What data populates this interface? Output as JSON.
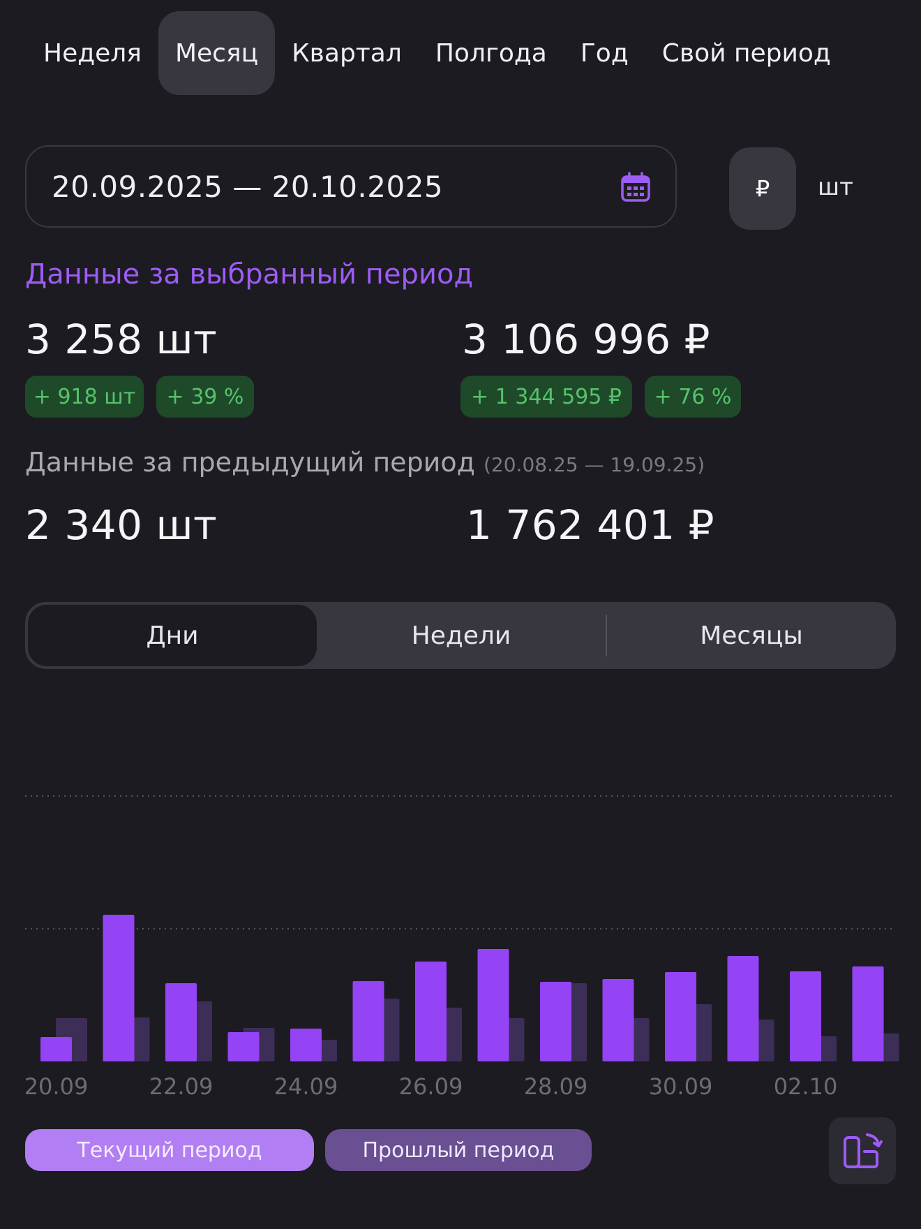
{
  "period_tabs": [
    {
      "label": "Неделя",
      "active": false
    },
    {
      "label": "Месяц",
      "active": true
    },
    {
      "label": "Квартал",
      "active": false
    },
    {
      "label": "Полгода",
      "active": false
    },
    {
      "label": "Год",
      "active": false
    },
    {
      "label": "Свой период",
      "active": false
    }
  ],
  "date_range": {
    "value": "20.09.2025 — 20.10.2025",
    "icon": "calendar-icon"
  },
  "unit_toggle": {
    "rub": "₽",
    "sht": "шт",
    "selected": "₽"
  },
  "selected_period": {
    "title": "Данные за выбранный период",
    "qty": "3 258 шт",
    "qty_badges": [
      "+ 918 шт",
      "+ 39 %"
    ],
    "sum": "3 106 996 ₽",
    "sum_badges": [
      "+ 1 344 595 ₽",
      "+ 76 %"
    ]
  },
  "previous_period": {
    "title": "Данные за предыдущий период",
    "range": "(20.08.25 — 19.09.25)",
    "qty": "2 340 шт",
    "sum": "1 762 401 ₽"
  },
  "granularity": {
    "options": [
      "Дни",
      "Недели",
      "Месяцы"
    ],
    "selected": "Дни"
  },
  "colors": {
    "current": "#9443f5",
    "previous": "#3d2e57",
    "badge_bg": "#1f4a2a",
    "badge_text": "#56c26b",
    "accent": "#9d5cf5"
  },
  "chart_data": {
    "type": "bar",
    "categories": [
      "20.09",
      "21.09",
      "22.09",
      "23.09",
      "24.09",
      "25.09",
      "26.09",
      "27.09",
      "28.09",
      "29.09",
      "30.09",
      "01.10",
      "02.10",
      "03.10"
    ],
    "tick_labels": [
      "20.09",
      "22.09",
      "24.09",
      "26.09",
      "28.09",
      "30.09",
      "02.10"
    ],
    "series": [
      {
        "name": "Текущий период",
        "values": [
          35,
          210,
          112,
          42,
          47,
          115,
          143,
          161,
          114,
          118,
          128,
          151,
          129,
          136
        ]
      },
      {
        "name": "Прошлый период",
        "values": [
          62,
          63,
          86,
          48,
          31,
          90,
          77,
          62,
          112,
          62,
          82,
          60,
          36,
          40
        ]
      }
    ],
    "grid": true
  },
  "legend": {
    "current": "Текущий период",
    "previous": "Прошлый период"
  },
  "rotate_button": {
    "icon": "rotate-screen-icon"
  }
}
